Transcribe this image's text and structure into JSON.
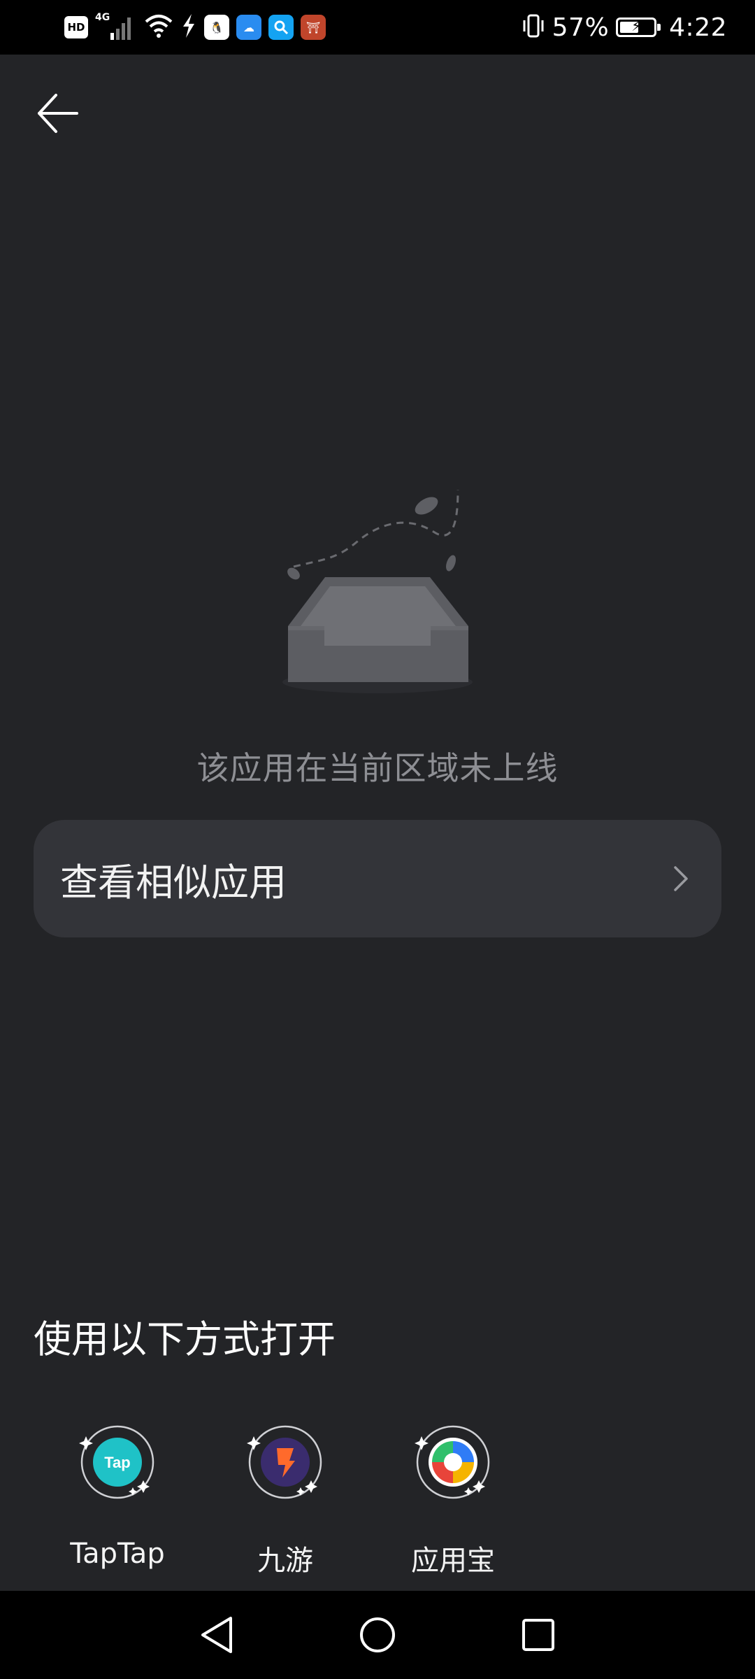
{
  "status_bar": {
    "network_badge": "HD",
    "network_type": "4G",
    "battery_percent": "57%",
    "battery_level": 0.57,
    "time": "4:22",
    "notification_icons": [
      "qq-icon",
      "cloud-icon",
      "search-app-icon",
      "game-icon"
    ]
  },
  "header": {
    "back_icon": "back-arrow-icon"
  },
  "empty_state": {
    "illustration": "empty-inbox-icon",
    "message": "该应用在当前区域未上线"
  },
  "similar_apps": {
    "label": "查看相似应用",
    "chevron_icon": "chevron-right-icon"
  },
  "open_with": {
    "title": "使用以下方式打开",
    "apps": [
      {
        "name": "TapTap",
        "icon": "taptap-icon",
        "color": "#1fc2c7"
      },
      {
        "name": "九游",
        "icon": "jiuyou-icon",
        "color": "#ff6a2b"
      },
      {
        "name": "应用宝",
        "icon": "yingyongbao-icon",
        "color": "#2f7cf6"
      }
    ]
  },
  "nav_bar": {
    "back_icon": "nav-back-icon",
    "home_icon": "nav-home-icon",
    "recents_icon": "nav-recents-icon"
  }
}
